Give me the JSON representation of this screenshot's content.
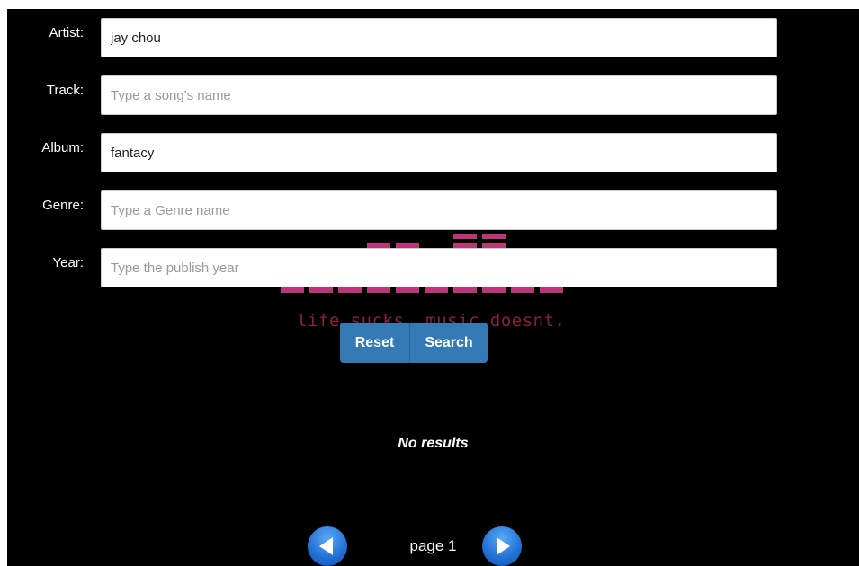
{
  "form": {
    "fields": [
      {
        "label": "Artist:",
        "value": "jay chou",
        "placeholder": ""
      },
      {
        "label": "Track:",
        "value": "",
        "placeholder": "Type a song's name"
      },
      {
        "label": "Album:",
        "value": "fantacy",
        "placeholder": ""
      },
      {
        "label": "Genre:",
        "value": "",
        "placeholder": "Type a Genre name"
      },
      {
        "label": "Year:",
        "value": "",
        "placeholder": "Type the publish year"
      }
    ],
    "reset_label": "Reset",
    "search_label": "Search"
  },
  "background": {
    "tagline": "life sucks. music doesnt."
  },
  "results": {
    "message": "No results"
  },
  "pagination": {
    "page_label": "page 1",
    "prev_icon": "arrow-left-icon",
    "next_icon": "arrow-right-icon"
  },
  "colors": {
    "background": "#000000",
    "button": "#337ab7",
    "nav_button": "#1f6fd6",
    "equalizer": "#e0408f"
  }
}
